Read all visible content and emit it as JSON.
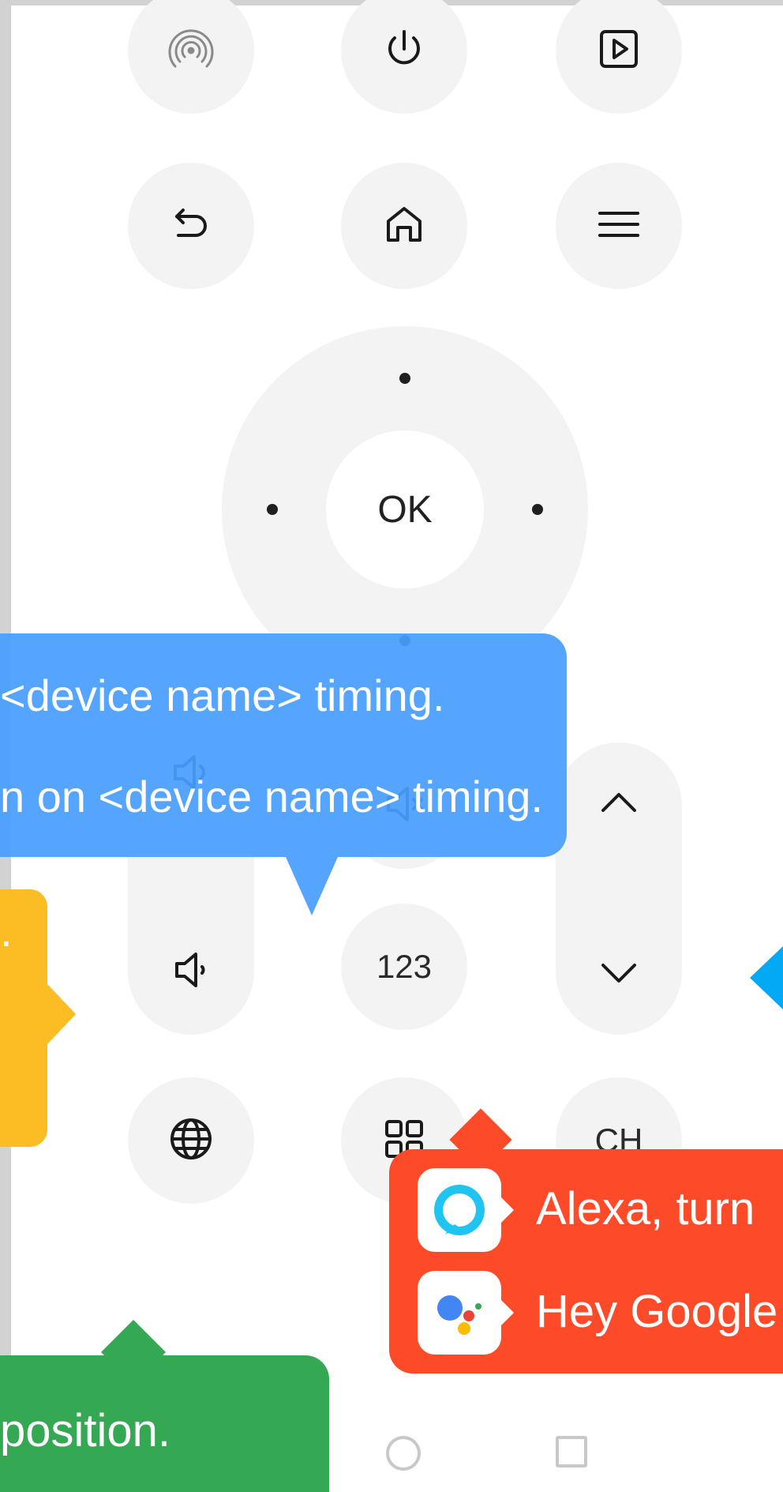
{
  "remote": {
    "ok_label": "OK",
    "numbers_label": "123",
    "channel_label": "CH",
    "icons": [
      "cast-icon",
      "power-icon",
      "input-source-icon",
      "back-icon",
      "home-icon",
      "menu-icon",
      "volume-up-icon",
      "mute-icon",
      "volume-down-icon",
      "channel-up-icon",
      "channel-down-icon",
      "globe-icon",
      "apps-icon"
    ]
  },
  "tooltips": {
    "blue_line1": "<device name> timing.",
    "blue_line2": "n on <device name> timing.",
    "yellow_fragment": ".",
    "red_alexa": "Alexa, turn",
    "red_google": "Hey Google",
    "green_fragment": "position."
  },
  "colors": {
    "blue": "#489eff",
    "yellow": "#fbbc24",
    "red": "#fd4b29",
    "green": "#34a853",
    "cyan": "#03a9f4",
    "button_bg": "#f3f3f3"
  }
}
